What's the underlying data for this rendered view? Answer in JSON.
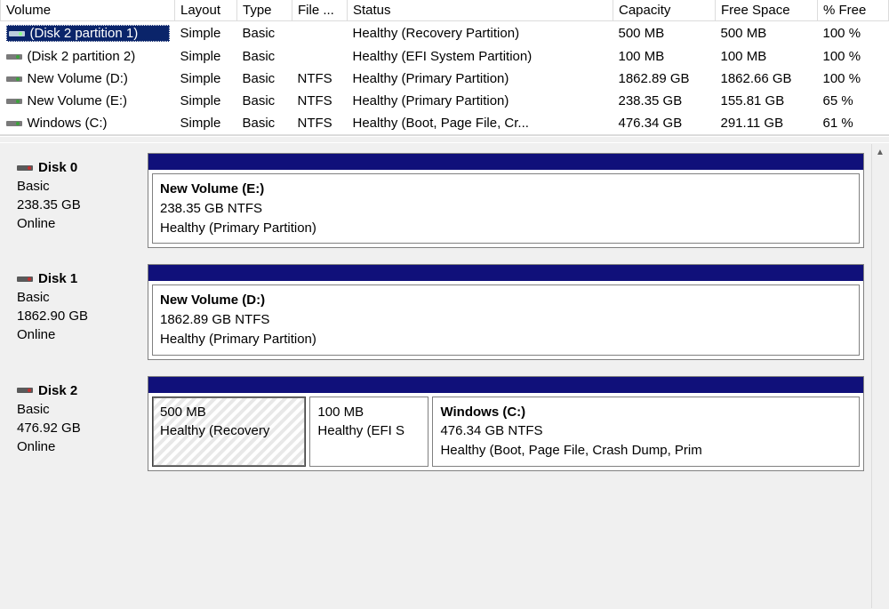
{
  "columns": {
    "volume": "Volume",
    "layout": "Layout",
    "type": "Type",
    "fs": "File ...",
    "status": "Status",
    "capacity": "Capacity",
    "free": "Free Space",
    "pct": "% Free"
  },
  "volumes": [
    {
      "name": "(Disk 2 partition 1)",
      "layout": "Simple",
      "type": "Basic",
      "fs": "",
      "status": "Healthy (Recovery Partition)",
      "capacity": "500 MB",
      "free": "500 MB",
      "pct": "100 %",
      "selected": true
    },
    {
      "name": "(Disk 2 partition 2)",
      "layout": "Simple",
      "type": "Basic",
      "fs": "",
      "status": "Healthy (EFI System Partition)",
      "capacity": "100 MB",
      "free": "100 MB",
      "pct": "100 %",
      "selected": false
    },
    {
      "name": "New Volume (D:)",
      "layout": "Simple",
      "type": "Basic",
      "fs": "NTFS",
      "status": "Healthy (Primary Partition)",
      "capacity": "1862.89 GB",
      "free": "1862.66 GB",
      "pct": "100 %",
      "selected": false
    },
    {
      "name": "New Volume (E:)",
      "layout": "Simple",
      "type": "Basic",
      "fs": "NTFS",
      "status": "Healthy (Primary Partition)",
      "capacity": "238.35 GB",
      "free": "155.81 GB",
      "pct": "65 %",
      "selected": false
    },
    {
      "name": "Windows (C:)",
      "layout": "Simple",
      "type": "Basic",
      "fs": "NTFS",
      "status": "Healthy (Boot, Page File, Cr...",
      "capacity": "476.34 GB",
      "free": "291.11 GB",
      "pct": "61 %",
      "selected": false
    }
  ],
  "disks": [
    {
      "name": "Disk 0",
      "type": "Basic",
      "size": "238.35 GB",
      "state": "Online",
      "partitions": [
        {
          "title": "New Volume  (E:)",
          "line2": "238.35 GB NTFS",
          "line3": "Healthy (Primary Partition)",
          "width": "100%",
          "selected": false
        }
      ]
    },
    {
      "name": "Disk 1",
      "type": "Basic",
      "size": "1862.90 GB",
      "state": "Online",
      "partitions": [
        {
          "title": "New Volume  (D:)",
          "line2": "1862.89 GB NTFS",
          "line3": "Healthy (Primary Partition)",
          "width": "100%",
          "selected": false
        }
      ]
    },
    {
      "name": "Disk 2",
      "type": "Basic",
      "size": "476.92 GB",
      "state": "Online",
      "partitions": [
        {
          "title": "",
          "line2": "500 MB",
          "line3": "Healthy (Recovery",
          "width": "22%",
          "selected": true
        },
        {
          "title": "",
          "line2": "100 MB",
          "line3": "Healthy (EFI S",
          "width": "17%",
          "selected": false
        },
        {
          "title": "Windows  (C:)",
          "line2": "476.34 GB NTFS",
          "line3": "Healthy (Boot, Page File, Crash Dump, Prim",
          "width": "61%",
          "selected": false
        }
      ]
    }
  ]
}
